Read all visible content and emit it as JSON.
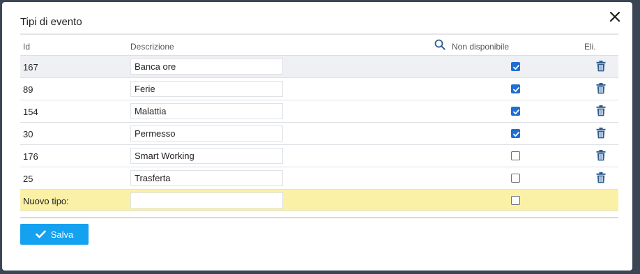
{
  "dialog": {
    "title": "Tipi di evento",
    "close_icon": "close-icon"
  },
  "columns": {
    "id": "Id",
    "description": "Descrizione",
    "unavailable": "Non disponibile",
    "delete": "Eli."
  },
  "rows": [
    {
      "id": "167",
      "description": "Banca ore",
      "unavailable": true
    },
    {
      "id": "89",
      "description": "Ferie",
      "unavailable": true
    },
    {
      "id": "154",
      "description": "Malattia",
      "unavailable": true
    },
    {
      "id": "30",
      "description": "Permesso",
      "unavailable": true
    },
    {
      "id": "176",
      "description": "Smart Working",
      "unavailable": false
    },
    {
      "id": "25",
      "description": "Trasferta",
      "unavailable": false
    }
  ],
  "new_row": {
    "label": "Nuovo tipo:",
    "description": "",
    "unavailable": false
  },
  "footer": {
    "save_label": "Salva"
  },
  "colors": {
    "accent": "#14a1f0",
    "checkbox": "#1f6ed4",
    "icon": "#2c5d91",
    "new_row_bg": "#fbf1a6",
    "selected_row_bg": "#eef0f3"
  }
}
